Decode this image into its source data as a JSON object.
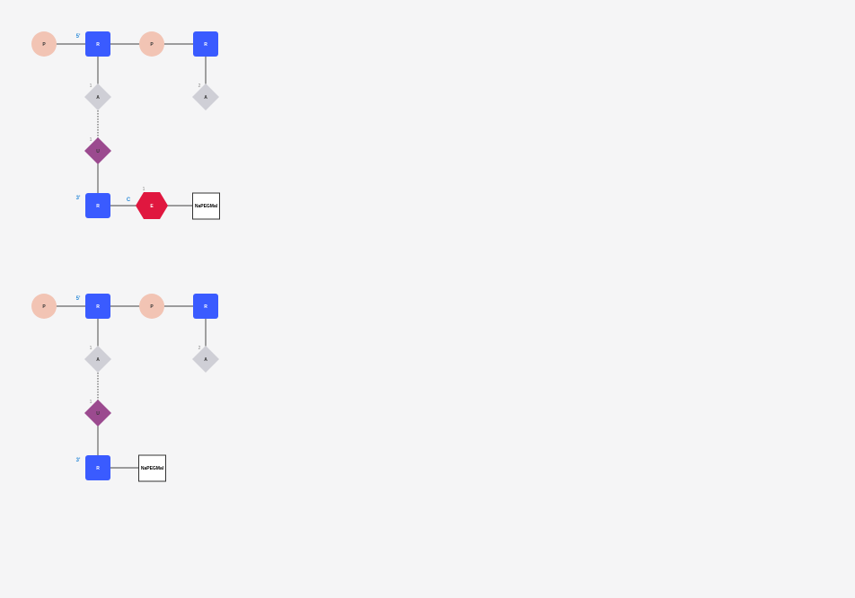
{
  "colors": {
    "phosphate": "#f2c4b4",
    "ribose": "#3a5bff",
    "adenine": "#cfcfd6",
    "uracil": "#9b4a8f",
    "e_monomer": "#e0173f",
    "end_label": "#2b8ad8",
    "background": "#f5f5f6",
    "line": "#666666"
  },
  "structure_top": {
    "phosphate_1": "P",
    "ribose_1": "R",
    "phosphate_2": "P",
    "ribose_2": "R",
    "base_a1": "A",
    "base_a1_num": "1",
    "base_a2": "A",
    "base_a2_num": "2",
    "base_u": "U",
    "base_u_num": "1",
    "ribose_3": "R",
    "e_monomer": "E",
    "e_num": "1",
    "linker": "NaPEGMal",
    "end_5": "5'",
    "end_3": "3'",
    "c_label": "C"
  },
  "structure_bottom": {
    "phosphate_1": "P",
    "ribose_1": "R",
    "phosphate_2": "P",
    "ribose_2": "R",
    "base_a1": "A",
    "base_a1_num": "1",
    "base_a2": "A",
    "base_a2_num": "2",
    "base_u": "U",
    "base_u_num": "1",
    "ribose_3": "R",
    "linker": "NaPEGMal",
    "end_5": "5'",
    "end_3": "3'"
  }
}
